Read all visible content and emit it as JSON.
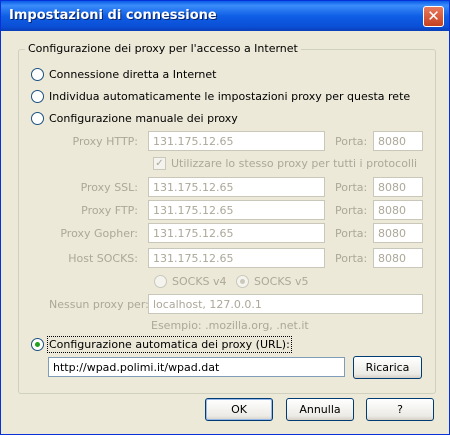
{
  "window": {
    "title": "Impostazioni di connessione",
    "close_glyph": "✕"
  },
  "group": {
    "legend": "Configurazione dei proxy per l'accesso a Internet"
  },
  "options": {
    "direct": "Connessione diretta a Internet",
    "autodetect": "Individua automaticamente le impostazioni proxy per questa rete",
    "manual": "Configurazione manuale dei proxy",
    "autoconfig": "Configurazione automatica dei proxy (URL):"
  },
  "manual": {
    "http": {
      "label": "Proxy HTTP:",
      "value": "131.175.12.65",
      "port_label": "Porta:",
      "port": "8080"
    },
    "same_for_all": "Utilizzare lo stesso proxy per tutti i protocolli",
    "ssl": {
      "label": "Proxy SSL:",
      "value": "131.175.12.65",
      "port_label": "Porta:",
      "port": "8080"
    },
    "ftp": {
      "label": "Proxy FTP:",
      "value": "131.175.12.65",
      "port_label": "Porta:",
      "port": "8080"
    },
    "gopher": {
      "label": "Proxy Gopher:",
      "value": "131.175.12.65",
      "port_label": "Porta:",
      "port": "8080"
    },
    "socks": {
      "label": "Host SOCKS:",
      "value": "131.175.12.65",
      "port_label": "Porta:",
      "port": "8080"
    },
    "socks_v4": "SOCKS v4",
    "socks_v5": "SOCKS v5",
    "no_proxy_label": "Nessun proxy per:",
    "no_proxy_value": "localhost, 127.0.0.1",
    "example": "Esempio: .mozilla.org, .net.it"
  },
  "autoconfig": {
    "url": "http://wpad.polimi.it/wpad.dat",
    "reload": "Ricarica"
  },
  "buttons": {
    "ok": "OK",
    "cancel": "Annulla",
    "help": "?"
  },
  "state": {
    "selected_option": "autoconfig",
    "same_for_all_checked": true,
    "socks_version": "v5"
  },
  "colors": {
    "titlebar": "#0a5ee8",
    "dialog": "#ece9d8",
    "radio_dot": "#21a121",
    "disabled_text": "#aca899"
  }
}
